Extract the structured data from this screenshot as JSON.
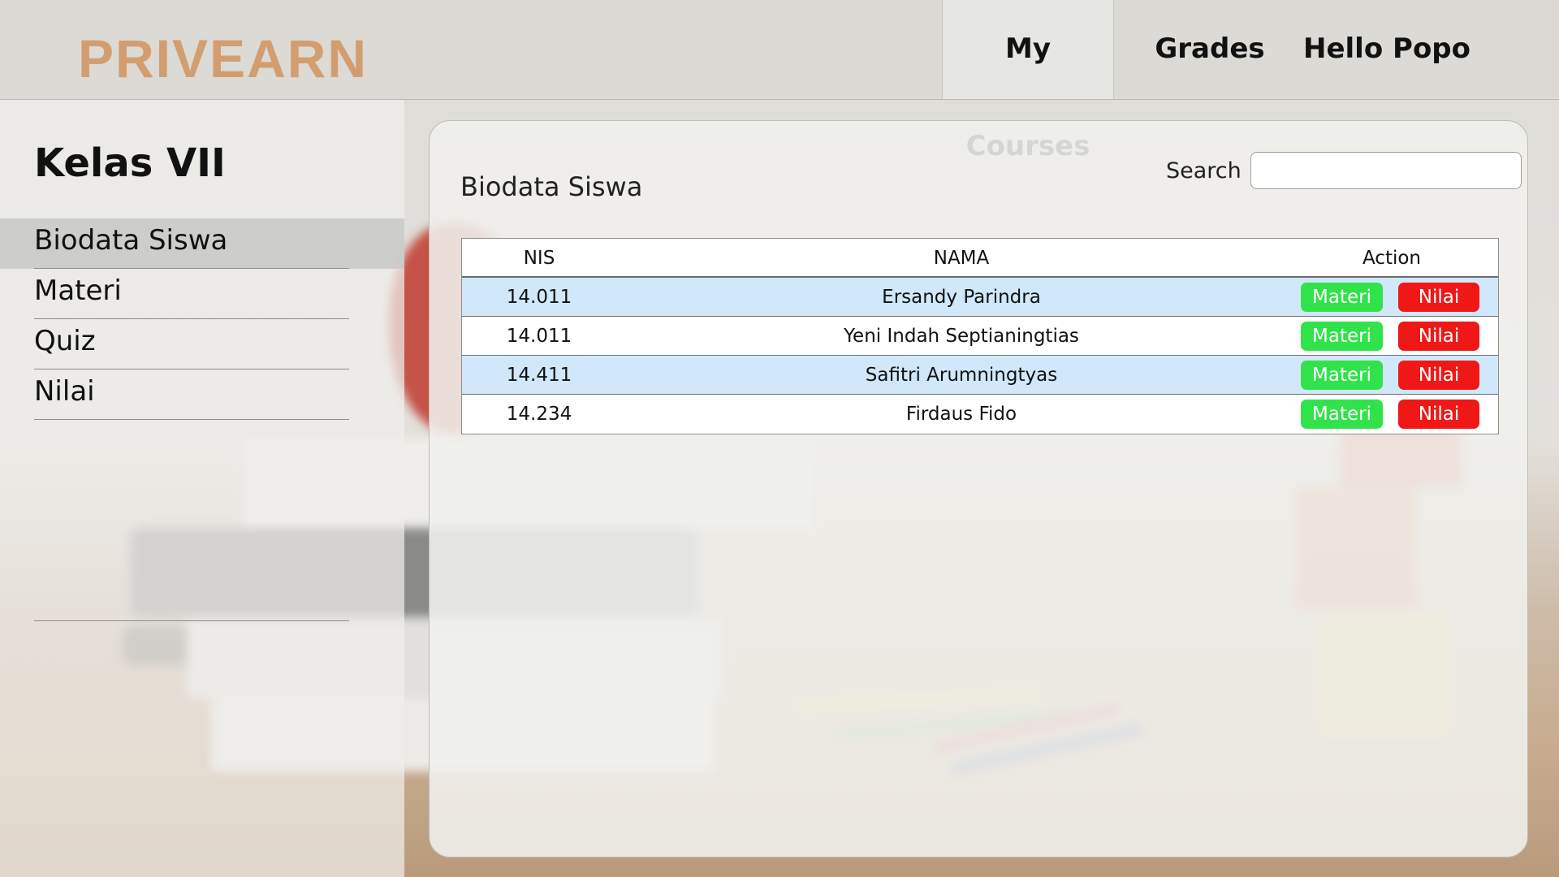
{
  "app": {
    "logo": "PRIVEARN"
  },
  "nav": {
    "courses": "My Courses",
    "grades": "Grades",
    "user": "Hello Popo"
  },
  "sidebar": {
    "title": "Kelas VII",
    "items": [
      {
        "label": "Biodata Siswa",
        "active": true
      },
      {
        "label": "Materi",
        "active": false
      },
      {
        "label": "Quiz",
        "active": false
      },
      {
        "label": "Nilai",
        "active": false
      }
    ]
  },
  "main": {
    "title": "Biodata Siswa",
    "search": {
      "label": "Search :",
      "value": "",
      "placeholder": ""
    },
    "table": {
      "columns": [
        "NIS",
        "NAMA",
        "Action"
      ],
      "rows": [
        {
          "nis": "14.011",
          "nama": "Ersandy Parindra",
          "materi": "Materi",
          "nilai": "Nilai"
        },
        {
          "nis": "14.011",
          "nama": "Yeni Indah Septianingtias",
          "materi": "Materi",
          "nilai": "Nilai"
        },
        {
          "nis": "14.411",
          "nama": "Safitri Arumningtyas",
          "materi": "Materi",
          "nilai": "Nilai"
        },
        {
          "nis": "14.234",
          "nama": "Firdaus Fido",
          "materi": "Materi",
          "nilai": "Nilai"
        }
      ]
    }
  },
  "colors": {
    "logo": "#d39e6f",
    "materi_button": "#30e34a",
    "nilai_button": "#f01717",
    "row_highlight": "#d0e8f9"
  }
}
